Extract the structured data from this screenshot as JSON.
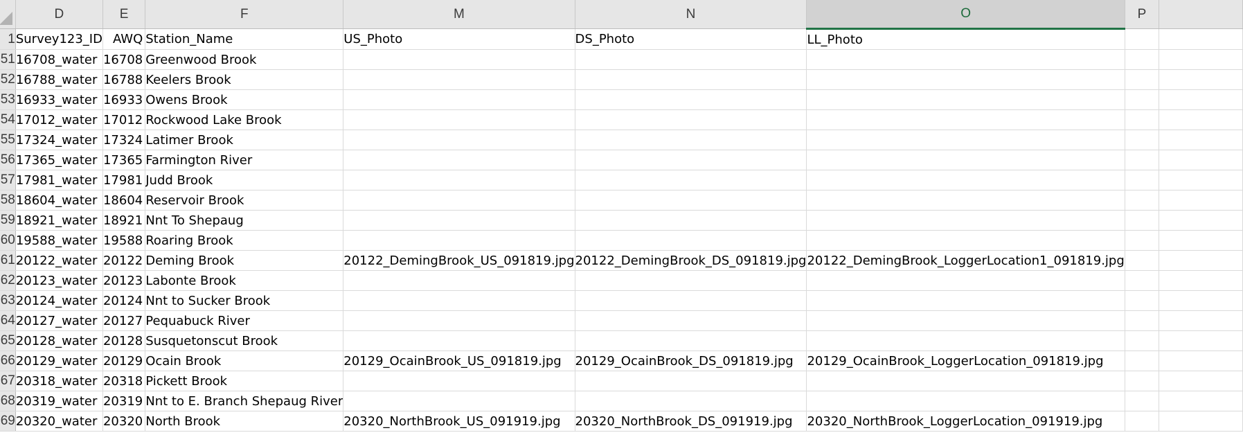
{
  "columns": {
    "D": "D",
    "E": "E",
    "F": "F",
    "M": "M",
    "N": "N",
    "O": "O",
    "P": "P"
  },
  "rows": [
    {
      "row": "1",
      "d": "Survey123_ID",
      "e": "AWQ",
      "f": "Station_Name",
      "m": "US_Photo",
      "n": "DS_Photo",
      "o": "LL_Photo",
      "p": ""
    },
    {
      "row": "51",
      "d": "16708_water",
      "e": "16708",
      "f": "Greenwood Brook",
      "m": "",
      "n": "",
      "o": "",
      "p": ""
    },
    {
      "row": "52",
      "d": "16788_water",
      "e": "16788",
      "f": "Keelers Brook",
      "m": "",
      "n": "",
      "o": "",
      "p": ""
    },
    {
      "row": "53",
      "d": "16933_water",
      "e": "16933",
      "f": "Owens Brook",
      "m": "",
      "n": "",
      "o": "",
      "p": ""
    },
    {
      "row": "54",
      "d": "17012_water",
      "e": "17012",
      "f": "Rockwood Lake Brook",
      "m": "",
      "n": "",
      "o": "",
      "p": ""
    },
    {
      "row": "55",
      "d": "17324_water",
      "e": "17324",
      "f": "Latimer Brook",
      "m": "",
      "n": "",
      "o": "",
      "p": ""
    },
    {
      "row": "56",
      "d": "17365_water",
      "e": "17365",
      "f": "Farmington River",
      "m": "",
      "n": "",
      "o": "",
      "p": ""
    },
    {
      "row": "57",
      "d": "17981_water",
      "e": "17981",
      "f": "Judd Brook",
      "m": "",
      "n": "",
      "o": "",
      "p": ""
    },
    {
      "row": "58",
      "d": "18604_water",
      "e": "18604",
      "f": "Reservoir Brook",
      "m": "",
      "n": "",
      "o": "",
      "p": ""
    },
    {
      "row": "59",
      "d": "18921_water",
      "e": "18921",
      "f": "Nnt To Shepaug",
      "m": "",
      "n": "",
      "o": "",
      "p": ""
    },
    {
      "row": "60",
      "d": "19588_water",
      "e": "19588",
      "f": "Roaring Brook",
      "m": "",
      "n": "",
      "o": "",
      "p": ""
    },
    {
      "row": "61",
      "d": "20122_water",
      "e": "20122",
      "f": "Deming Brook",
      "m": "20122_DemingBrook_US_091819.jpg",
      "n": "20122_DemingBrook_DS_091819.jpg",
      "o": "20122_DemingBrook_LoggerLocation1_091819.jpg",
      "p": ""
    },
    {
      "row": "62",
      "d": "20123_water",
      "e": "20123",
      "f": "Labonte Brook",
      "m": "",
      "n": "",
      "o": "",
      "p": ""
    },
    {
      "row": "63",
      "d": "20124_water",
      "e": "20124",
      "f": "Nnt to Sucker Brook",
      "m": "",
      "n": "",
      "o": "",
      "p": ""
    },
    {
      "row": "64",
      "d": "20127_water",
      "e": "20127",
      "f": "Pequabuck River",
      "m": "",
      "n": "",
      "o": "",
      "p": ""
    },
    {
      "row": "65",
      "d": "20128_water",
      "e": "20128",
      "f": "Susquetonscut Brook",
      "m": "",
      "n": "",
      "o": "",
      "p": ""
    },
    {
      "row": "66",
      "d": "20129_water",
      "e": "20129",
      "f": "Ocain Brook",
      "m": "20129_OcainBrook_US_091819.jpg",
      "n": "20129_OcainBrook_DS_091819.jpg",
      "o": "20129_OcainBrook_LoggerLocation_091819.jpg",
      "p": ""
    },
    {
      "row": "67",
      "d": "20318_water",
      "e": "20318",
      "f": "Pickett Brook",
      "m": "",
      "n": "",
      "o": "",
      "p": ""
    },
    {
      "row": "68",
      "d": "20319_water",
      "e": "20319",
      "f": "Nnt to E. Branch Shepaug River",
      "m": "",
      "n": "",
      "o": "",
      "p": ""
    },
    {
      "row": "69",
      "d": "20320_water",
      "e": "20320",
      "f": "North Brook",
      "m": "20320_NorthBrook_US_091919.jpg",
      "n": "20320_NorthBrook_DS_091919.jpg",
      "o": "20320_NorthBrook_LoggerLocation_091919.jpg",
      "p": ""
    }
  ],
  "selected_column": "O",
  "colors": {
    "header_bg": "#e6e6e6",
    "selected_header_bg": "#d2d2d2",
    "selected_accent": "#217346",
    "gridline": "#dadada"
  }
}
